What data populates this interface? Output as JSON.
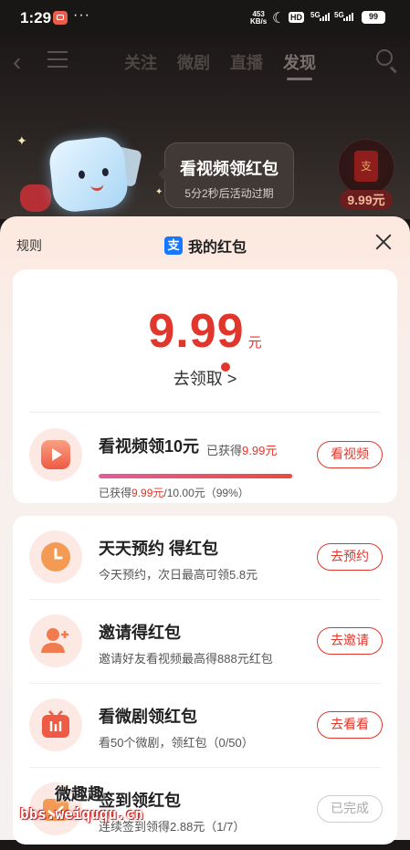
{
  "status": {
    "time": "1:29",
    "dots": "···",
    "net_speed_top": "453",
    "net_speed_bottom": "KB/s",
    "hd": "HD",
    "sig1": "5G",
    "sig2": "5G",
    "battery": "99"
  },
  "nav": {
    "tabs": [
      "关注",
      "微剧",
      "直播",
      "发现"
    ],
    "active_tab": "发现"
  },
  "banner": {
    "title": "看视频领红包",
    "subtitle": "5分2秒后活动过期",
    "redpack_label": "支",
    "redpack_amount": "9.99元"
  },
  "sheet": {
    "rules": "规则",
    "title": "我的红包",
    "alipay_glyph": "支",
    "amount": "9.99",
    "amount_unit": "元",
    "claim": "去领取 >"
  },
  "video_task": {
    "title": "看视频领10元",
    "earned_prefix": "已获得",
    "earned_amount": "9.99元",
    "progress_prefix": "已获得",
    "progress_amount": "9.99元",
    "progress_suffix": "/10.00元（99%）",
    "progress_fraction": 0.99,
    "button": "看视频"
  },
  "tasks": [
    {
      "title": "天天预约 得红包",
      "subtitle": "今天预约，次日最高可领5.8元",
      "button": "去预约",
      "icon": "clock-icon"
    },
    {
      "title": "邀请得红包",
      "subtitle": "邀请好友看视频最高得888元红包",
      "button": "去邀请",
      "icon": "add-user-icon"
    },
    {
      "title": "看微剧领红包",
      "subtitle": "看50个微剧，领红包（0/50）",
      "button": "去看看",
      "icon": "tv-icon"
    },
    {
      "title": "签到领红包",
      "subtitle": "连续签到领得2.88元（1/7）",
      "button": "已完成",
      "icon": "calendar-icon"
    }
  ],
  "watermark": {
    "line1": "微趣趣",
    "line2": "bbs.weiququ.cn"
  }
}
